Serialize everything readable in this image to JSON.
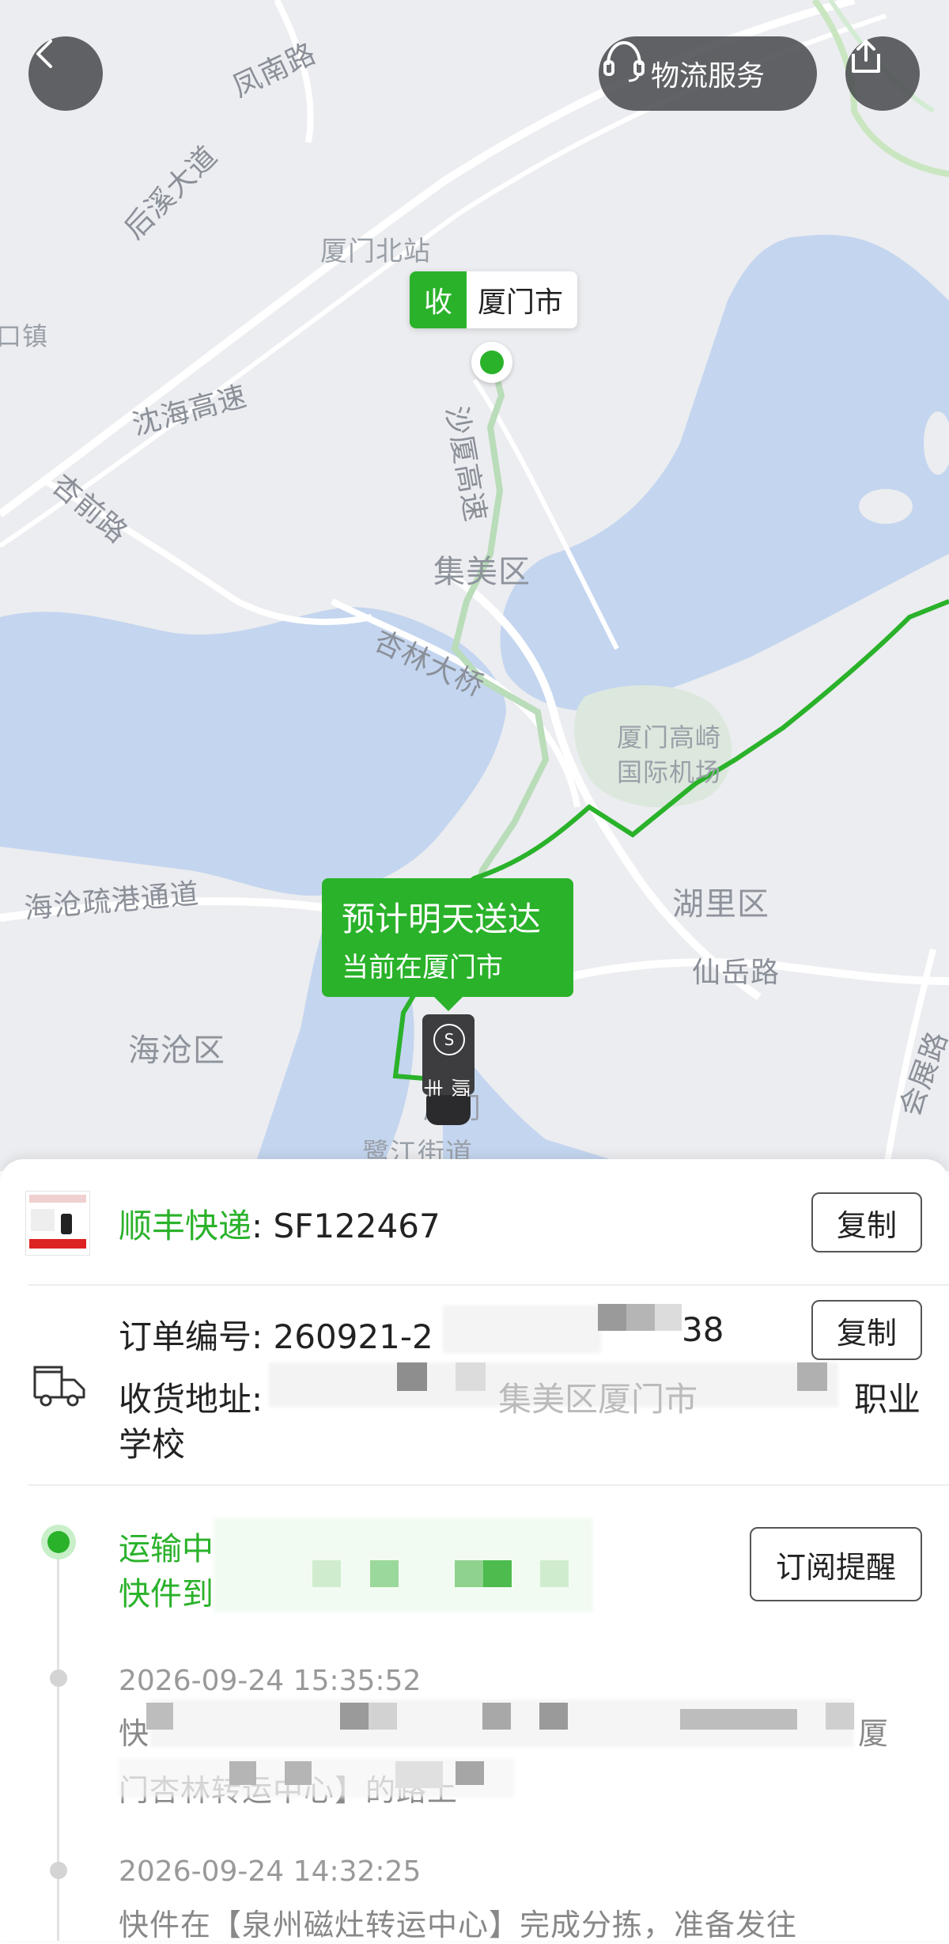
{
  "map": {
    "labels": {
      "fengnan_road": "凤南路",
      "houxi_avenue": "后溪大道",
      "xiamen_north_station": "厦门北站",
      "jiaokou_town": "灌口镇",
      "shenhai_expressway": "沈海高速",
      "xingqian_road": "杏前路",
      "shaxia_expressway": "沙厦高速",
      "jimei_district": "集美区",
      "xinglin_bridge": "杏林大桥",
      "gaoqi_airport": "厦门高崎\n国际机场",
      "haicang_port_channel": "海沧疏港通道",
      "huli_district": "湖里区",
      "xianyue_road": "仙岳路",
      "huizhan_road": "会展路",
      "haicang_district": "海沧区",
      "xiamen_label": "厦门",
      "lujiang_street": "鹭江街道"
    },
    "receive_tag": {
      "key": "收",
      "city": "厦门市"
    },
    "eta": {
      "line1": "预计明天送达",
      "line2": "当前在厦门市"
    },
    "truck_brand": "顺丰",
    "colors": {
      "route": "#2ab22a",
      "water": "#c4d5ef",
      "land": "#ecedf0"
    }
  },
  "header": {
    "back_icon": "chevron-left-icon",
    "logistics_service": "物流服务",
    "share_icon": "share-icon"
  },
  "shipment": {
    "carrier_label": "顺丰快递",
    "tracking_number": ": SF122467",
    "copy_label": "复制",
    "order_label": "订单编号",
    "order_number": ": 260921-2",
    "order_suffix": "38",
    "address_label": "收货地址:",
    "address_visible_part": "集美区厦门市",
    "address_suffix": "职业",
    "address_line2": "学校"
  },
  "status": {
    "current_line1": "运输中",
    "current_line2": "快件到",
    "subscribe_label": "订阅提醒"
  },
  "events": [
    {
      "time": "2026-09-24 15:35:52",
      "line1_start": "快",
      "line1_end": "厦",
      "line2": "门杏林转运中心】的路上"
    },
    {
      "time": "2026-09-24 14:32:25",
      "line1": "快件在【泉州磁灶转运中心】完成分拣，准备发往"
    }
  ]
}
